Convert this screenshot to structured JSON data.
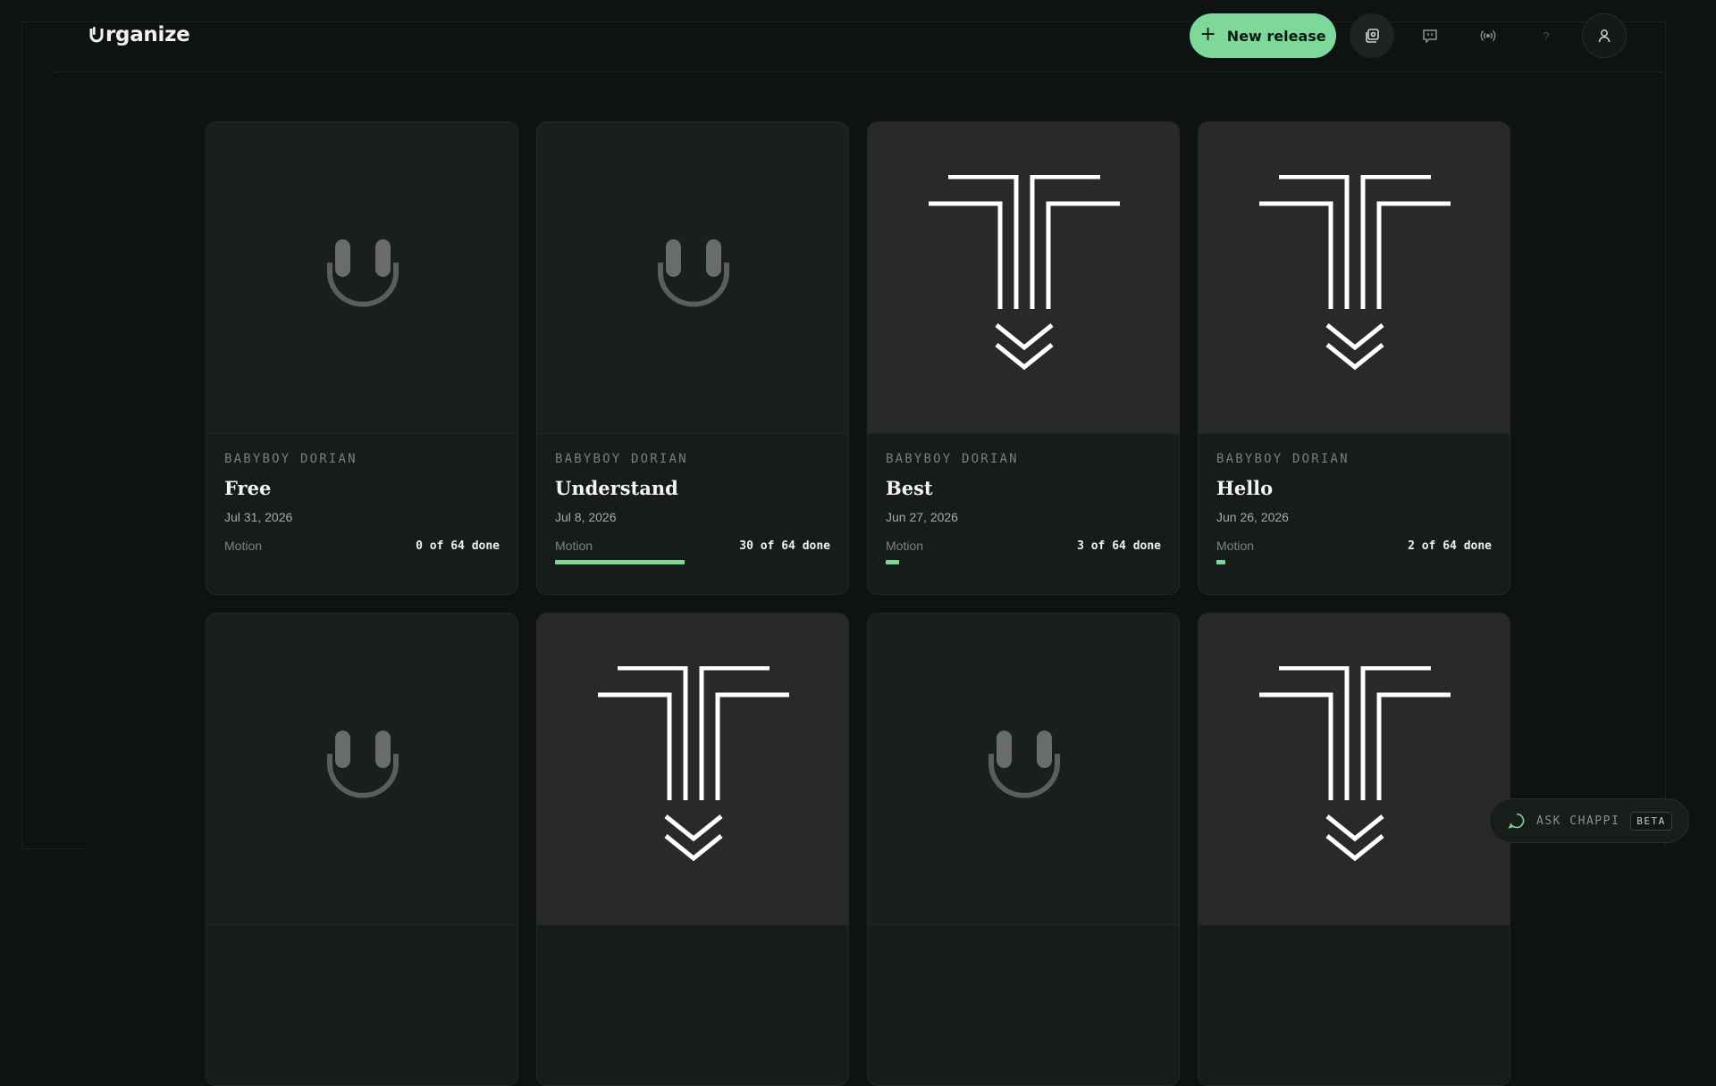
{
  "app": {
    "logo_text": "rganize"
  },
  "header": {
    "new_release_label": "New release",
    "icons": [
      "library-icon",
      "feedback-icon",
      "broadcast-icon",
      "help-icon",
      "user-icon"
    ]
  },
  "releases": [
    {
      "artist": "BABYBOY DORIAN",
      "title": "Free",
      "date": "Jul 31, 2026",
      "type": "Motion",
      "progress_text": "0 of 64 done",
      "progress": 0,
      "art": "placeholder"
    },
    {
      "artist": "BABYBOY DORIAN",
      "title": "Understand",
      "date": "Jul 8, 2026",
      "type": "Motion",
      "progress_text": "30 of 64 done",
      "progress": 0.469,
      "art": "placeholder"
    },
    {
      "artist": "BABYBOY DORIAN",
      "title": "Best",
      "date": "Jun 27, 2026",
      "type": "Motion",
      "progress_text": "3 of 64 done",
      "progress": 0.047,
      "art": "cover"
    },
    {
      "artist": "BABYBOY DORIAN",
      "title": "Hello",
      "date": "Jun 26, 2026",
      "type": "Motion",
      "progress_text": "2 of 64 done",
      "progress": 0.031,
      "art": "cover"
    },
    {
      "art": "placeholder"
    },
    {
      "art": "cover"
    },
    {
      "art": "placeholder"
    },
    {
      "art": "cover"
    }
  ],
  "assistant": {
    "label": "ASK CHAPPI",
    "badge": "BETA"
  },
  "colors": {
    "accent": "#7ed89a",
    "background": "#0e1210"
  }
}
